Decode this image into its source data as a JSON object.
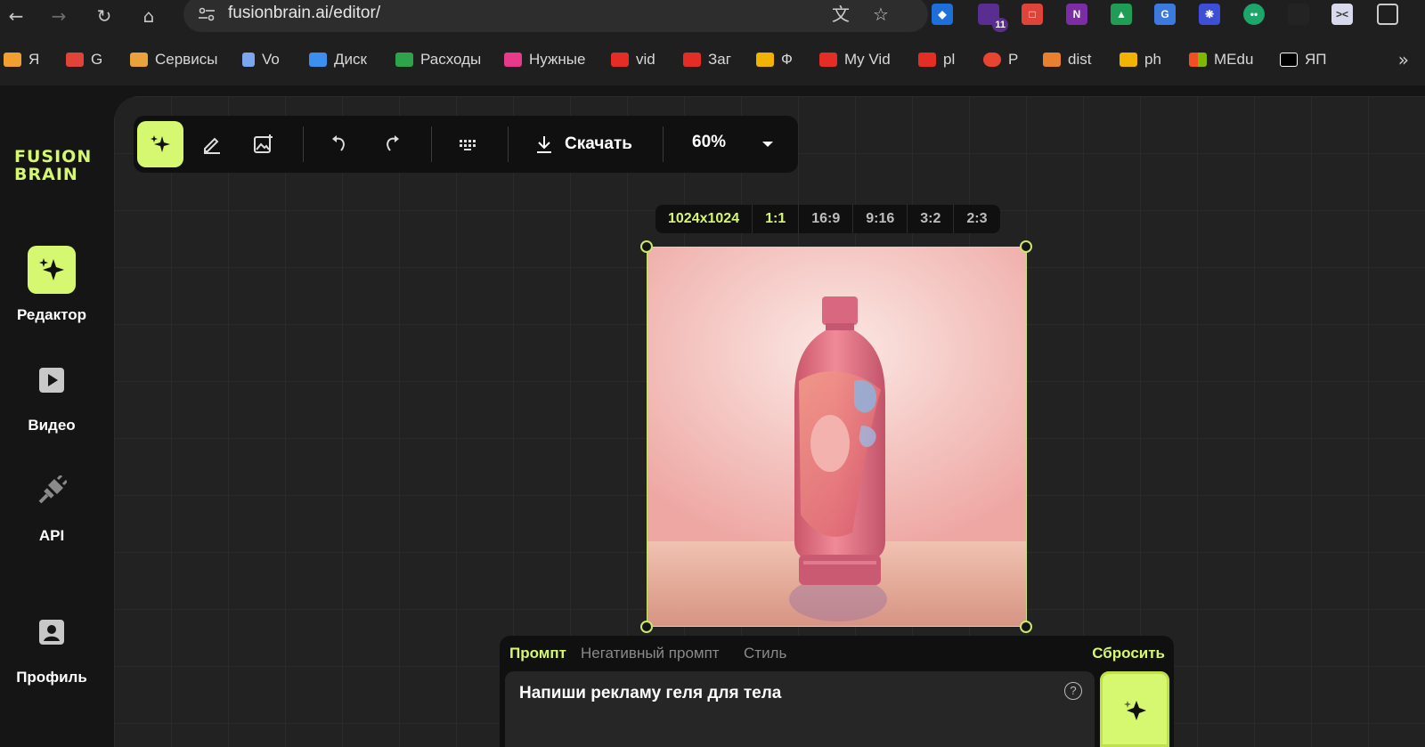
{
  "browser": {
    "url": "fusionbrain.ai/editor/",
    "extension_badge": "11",
    "bookmarks": [
      {
        "label": "Я",
        "color": "#f0a030"
      },
      {
        "label": "G",
        "color": "#e0433a"
      },
      {
        "label": "Сервисы",
        "color": "#e8a33a"
      },
      {
        "label": "Vo",
        "color": "#7aa7f0"
      },
      {
        "label": "Диск",
        "color": "#3c8ef0"
      },
      {
        "label": "Расходы",
        "color": "#2fa24c"
      },
      {
        "label": "Нужные",
        "color": "#e83a8a"
      },
      {
        "label": "vid",
        "color": "#e52d27"
      },
      {
        "label": "Заг",
        "color": "#e52d27"
      },
      {
        "label": "Ф",
        "color": "#f0b400"
      },
      {
        "label": "My Vid",
        "color": "#e52d27"
      },
      {
        "label": "pl",
        "color": "#e52d27"
      },
      {
        "label": "P",
        "color": "#e8442f"
      },
      {
        "label": "dist",
        "color": "#e8812f"
      },
      {
        "label": "ph",
        "color": "#f0b400"
      },
      {
        "label": "MEdu",
        "color": "#f25022"
      },
      {
        "label": "ЯП",
        "color": "#000000"
      }
    ]
  },
  "app": {
    "logo_line1": "FUSION",
    "logo_line2": "BRAIN",
    "sidebar": [
      {
        "label": "Редактор",
        "icon": "sparkle-icon",
        "active": true
      },
      {
        "label": "Видео",
        "icon": "play-icon",
        "active": false
      },
      {
        "label": "API",
        "icon": "plug-icon",
        "active": false
      },
      {
        "label": "Профиль",
        "icon": "profile-icon",
        "active": false
      }
    ],
    "toolbar": {
      "download_label": "Скачать",
      "zoom": "60%"
    },
    "ratios": [
      "1024x1024",
      "1:1",
      "16:9",
      "9:16",
      "3:2",
      "2:3"
    ],
    "prompt": {
      "tabs": [
        "Промпт",
        "Негативный промпт",
        "Стиль"
      ],
      "reset_label": "Сбросить",
      "text": "Напиши рекламу геля для тела",
      "help": "?"
    },
    "colors": {
      "accent": "#d6f870",
      "background": "#151515",
      "canvas": "#222222"
    }
  }
}
